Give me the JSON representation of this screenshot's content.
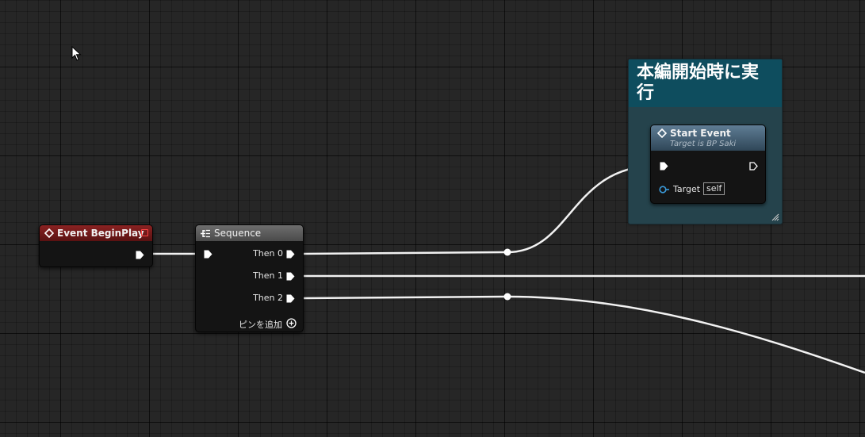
{
  "comment": {
    "title": "本編開始時に実行"
  },
  "nodes": {
    "event_beginplay": {
      "title": "Event BeginPlay",
      "header_color": "#7a1b1b"
    },
    "sequence": {
      "title": "Sequence",
      "outputs": [
        "Then 0",
        "Then 1",
        "Then 2"
      ],
      "add_pin_label": "ピンを追加"
    },
    "start_event": {
      "title": "Start Event",
      "subtitle": "Target is BP Saki",
      "target_label": "Target",
      "target_value": "self"
    }
  },
  "colors": {
    "grid_bg": "#262626",
    "wire": "#ffffff",
    "comment_header": "#0e4d5e",
    "comment_body": "#25434c",
    "target_pin": "#3a9ad9"
  }
}
